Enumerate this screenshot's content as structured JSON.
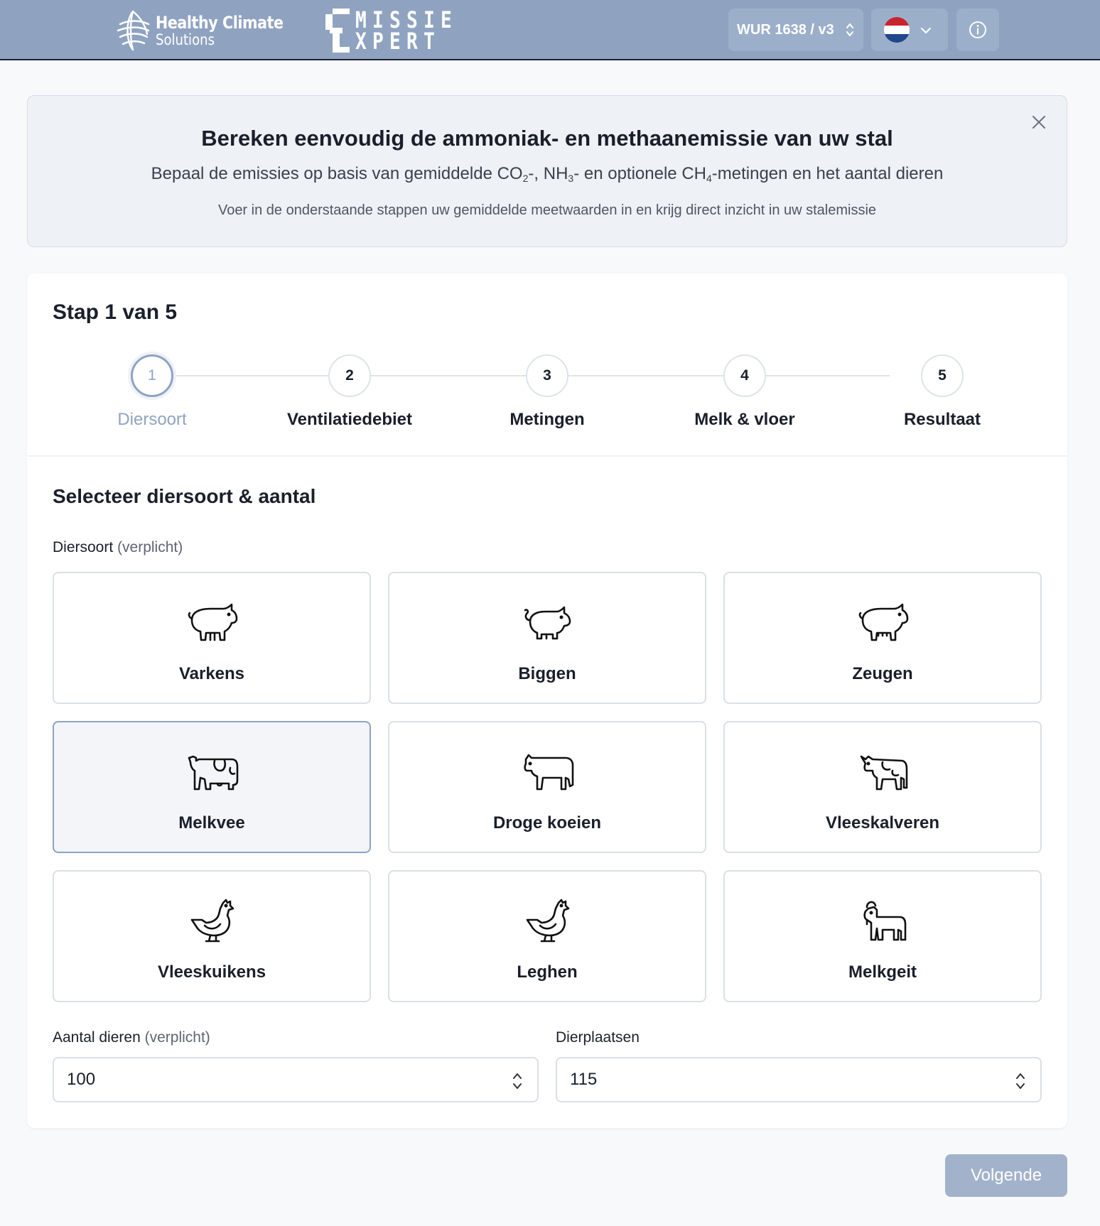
{
  "header": {
    "brand_line1": "Healthy Climate",
    "brand_line2": "Solutions",
    "emissie_line1": "MISSIE",
    "emissie_line2": "XPERT",
    "version_select": "WUR 1638 / v3",
    "language_flag": "nl-flag-icon",
    "colors": {
      "bar": "#8fa3c1",
      "accent": "#8fa3c1"
    }
  },
  "banner": {
    "title": "Bereken eenvoudig de ammoniak- en methaanemissie van uw stal",
    "subtitle_part1": "Bepaal de emissies op basis van gemiddelde CO",
    "subtitle_sub1": "2",
    "subtitle_part2": "-, NH",
    "subtitle_sub2": "3",
    "subtitle_part3": "- en optionele CH",
    "subtitle_sub3": "4",
    "subtitle_part4": "-metingen en het aantal dieren",
    "note": "Voer in de onderstaande stappen uw gemiddelde meetwaarden in en krijg direct inzicht in uw stalemissie"
  },
  "stepper": {
    "title": "Stap 1 van 5",
    "steps": [
      {
        "number": "1",
        "label": "Diersoort",
        "active": true
      },
      {
        "number": "2",
        "label": "Ventilatiedebiet",
        "active": false
      },
      {
        "number": "3",
        "label": "Metingen",
        "active": false
      },
      {
        "number": "4",
        "label": "Melk & vloer",
        "active": false
      },
      {
        "number": "5",
        "label": "Resultaat",
        "active": false
      }
    ]
  },
  "form": {
    "section_title": "Selecteer diersoort & aantal",
    "animal_label": "Diersoort",
    "animal_required": "(verplicht)",
    "animals": [
      {
        "label": "Varkens",
        "icon": "pig-icon",
        "selected": false
      },
      {
        "label": "Biggen",
        "icon": "piglet-icon",
        "selected": false
      },
      {
        "label": "Zeugen",
        "icon": "sow-icon",
        "selected": false
      },
      {
        "label": "Melkvee",
        "icon": "dairy-cow-icon",
        "selected": true
      },
      {
        "label": "Droge koeien",
        "icon": "dry-cow-icon",
        "selected": false
      },
      {
        "label": "Vleeskalveren",
        "icon": "calf-icon",
        "selected": false
      },
      {
        "label": "Vleeskuikens",
        "icon": "broiler-chicken-icon",
        "selected": false
      },
      {
        "label": "Leghen",
        "icon": "laying-hen-icon",
        "selected": false
      },
      {
        "label": "Melkgeit",
        "icon": "goat-icon",
        "selected": false
      }
    ],
    "count_label": "Aantal dieren",
    "count_required": "(verplicht)",
    "count_value": "100",
    "places_label": "Dierplaatsen",
    "places_value": "115",
    "next_button": "Volgende"
  }
}
